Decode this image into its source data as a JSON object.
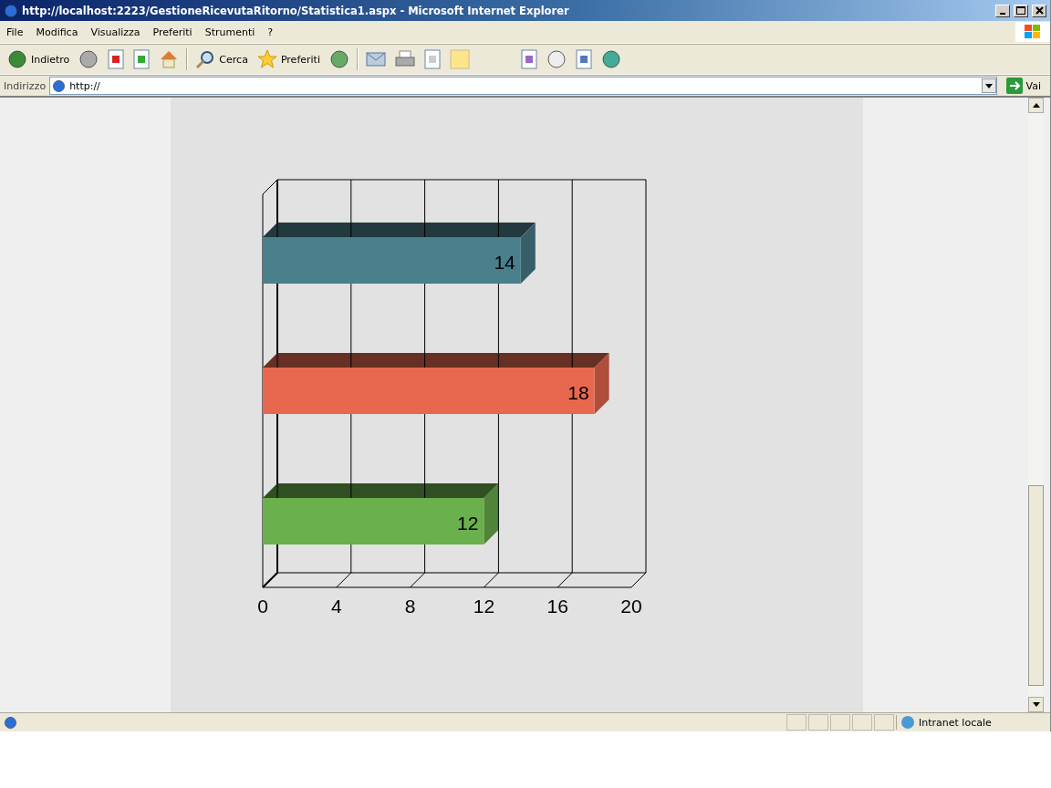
{
  "window": {
    "title": "http://localhost:2223/GestioneRicevutaRitorno/Statistica1.aspx - Microsoft Internet Explorer"
  },
  "menu": [
    "File",
    "Modifica",
    "Visualizza",
    "Preferiti",
    "Strumenti",
    "?"
  ],
  "toolbar": {
    "back": "Indietro",
    "search": "Cerca",
    "favorites": "Preferiti"
  },
  "address_bar": {
    "label": "Indirizzo",
    "value": "http://",
    "go": "Vai"
  },
  "chart": {
    "chart_data": {
      "type": "bar",
      "orientation": "horizontal",
      "xlim": [
        0,
        20
      ],
      "xticks": [
        0,
        4,
        8,
        12,
        16,
        20
      ],
      "data_labels": true,
      "series": [
        {
          "color": "#4a7f8c",
          "values": [
            14
          ]
        },
        {
          "color": "#e8684f",
          "values": [
            18
          ]
        },
        {
          "color": "#6ab04c",
          "values": [
            12
          ]
        }
      ]
    }
  },
  "status_bar": {
    "zone": "Intranet locale"
  }
}
